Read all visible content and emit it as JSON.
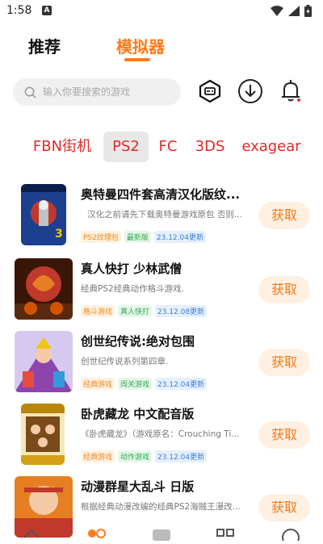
{
  "status": {
    "time": "1:58",
    "notif_letter": "A"
  },
  "tabs": [
    {
      "label": "推荐",
      "active": false
    },
    {
      "label": "模拟器",
      "active": true
    }
  ],
  "search": {
    "placeholder": "输入你要搜索的游戏"
  },
  "filters": [
    {
      "label": "FBN街机",
      "active": false
    },
    {
      "label": "PS2",
      "active": true
    },
    {
      "label": "FC",
      "active": false
    },
    {
      "label": "3DS",
      "active": false
    },
    {
      "label": "exagear",
      "active": false
    }
  ],
  "games": [
    {
      "title": "奥特曼四件套高清汉化版纹...",
      "desc": "汉化之前请先下载奥特曼游戏原包 否则...",
      "tags": [
        {
          "text": "PS2纹理包",
          "color": "orange"
        },
        {
          "text": "最新版",
          "color": "green"
        },
        {
          "text": "23.12.04更新",
          "color": "blue"
        }
      ],
      "button": "获取"
    },
    {
      "title": "真人快打 少林武僧",
      "desc": "经典PS2经典动作格斗游戏.",
      "tags": [
        {
          "text": "格斗游戏",
          "color": "orange"
        },
        {
          "text": "真人快打",
          "color": "green"
        },
        {
          "text": "23.12.08更新",
          "color": "blue"
        }
      ],
      "button": "获取"
    },
    {
      "title": "创世纪传说:绝对包围",
      "desc": "创世纪传说系列第四章.",
      "tags": [
        {
          "text": "经典游戏",
          "color": "orange"
        },
        {
          "text": "闯关游戏",
          "color": "green"
        },
        {
          "text": "23.12.04更新",
          "color": "blue"
        }
      ],
      "button": "获取"
    },
    {
      "title": "卧虎藏龙 中文配音版",
      "desc": "《卧虎藏龙》（游戏原名：Crouching Ti...",
      "tags": [
        {
          "text": "经典游戏",
          "color": "orange"
        },
        {
          "text": "动作游戏",
          "color": "green"
        },
        {
          "text": "23.12.04更新",
          "color": "blue"
        }
      ],
      "button": "获取"
    },
    {
      "title": "动漫群星大乱斗 日版",
      "desc": "根据经典动漫改编的经典PS2海贼王漫改...",
      "tags": [],
      "button": "获取"
    }
  ],
  "colors": {
    "accent": "#ff7a1a",
    "filter_red": "#e02a2a"
  }
}
